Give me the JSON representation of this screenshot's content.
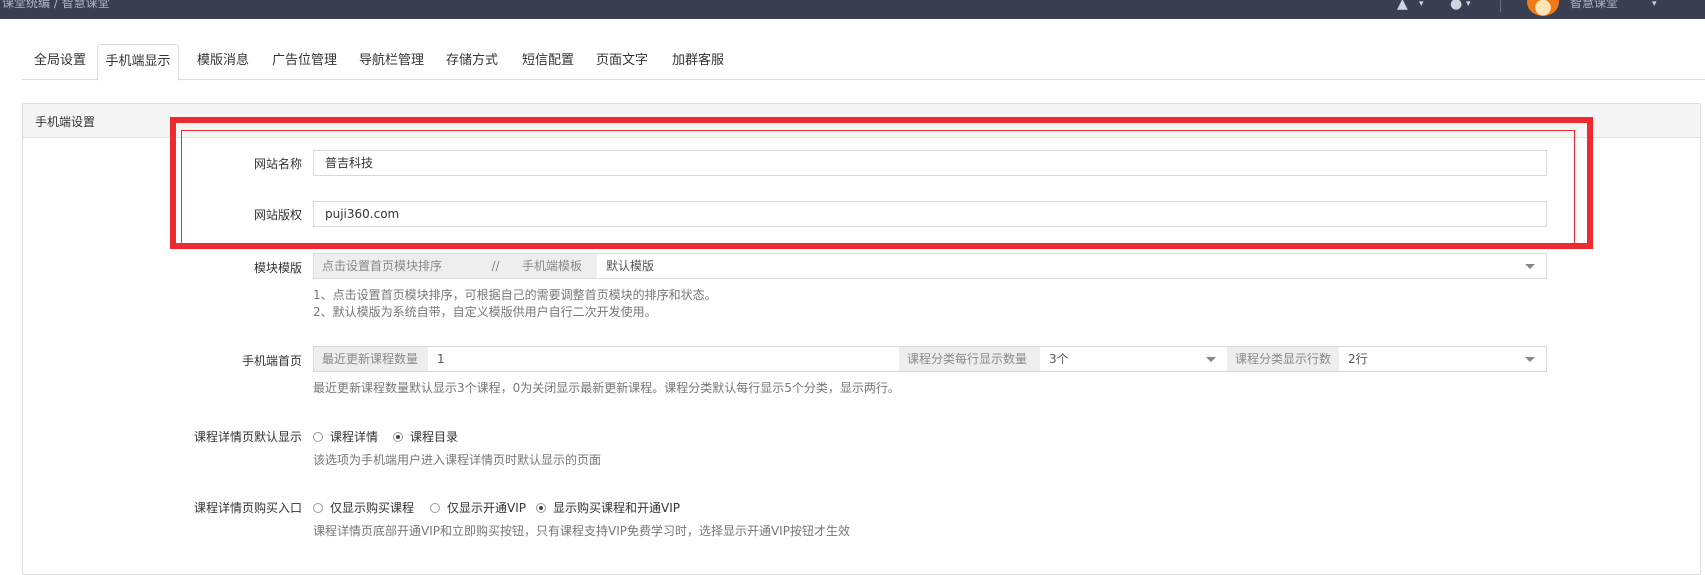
{
  "topbar": {
    "breadcrumb": "课堂统编 / 智慧课堂",
    "user_name": "智慧课堂",
    "bell_icon": "bell-icon",
    "user_icon": "user-icon",
    "chevron_icon": "chevron-down-icon"
  },
  "tabs": [
    {
      "label": "全局设置",
      "active": false
    },
    {
      "label": "手机端显示",
      "active": true
    },
    {
      "label": "模版消息",
      "active": false
    },
    {
      "label": "广告位管理",
      "active": false
    },
    {
      "label": "导航栏管理",
      "active": false
    },
    {
      "label": "存储方式",
      "active": false
    },
    {
      "label": "短信配置",
      "active": false
    },
    {
      "label": "页面文字",
      "active": false
    },
    {
      "label": "加群客服",
      "active": false
    }
  ],
  "panel": {
    "title": "手机端设置",
    "site_name": {
      "label": "网站名称",
      "value": "普吉科技"
    },
    "site_copyright": {
      "label": "网站版权",
      "value": "puji360.com"
    },
    "module_template": {
      "label": "模块模版",
      "addon_sort": "点击设置首页模块排序",
      "separator": "//",
      "addon_template": "手机端模板",
      "selected": "默认模版",
      "help_1": "1、点击设置首页模块排序，可根据自己的需要调整首页模块的排序和状态。",
      "help_2": "2、默认模版为系统自带，自定义模版供用户自行二次开发使用。"
    },
    "mobile_home": {
      "label": "手机端首页",
      "addon_recent": "最近更新课程数量",
      "recent_value": "1",
      "addon_per_row": "课程分类每行显示数量",
      "per_row_value": "3个",
      "addon_rows": "课程分类显示行数",
      "rows_value": "2行",
      "help": "最近更新课程数量默认显示3个课程，0为关闭显示最新更新课程。课程分类默认每行显示5个分类，显示两行。"
    },
    "detail_default": {
      "label": "课程详情页默认显示",
      "options": [
        {
          "label": "课程详情",
          "checked": false
        },
        {
          "label": "课程目录",
          "checked": true
        }
      ],
      "help": "该选项为手机端用户进入课程详情页时默认显示的页面"
    },
    "detail_buy": {
      "label": "课程详情页购买入口",
      "options": [
        {
          "label": "仅显示购买课程",
          "checked": false
        },
        {
          "label": "仅显示开通VIP",
          "checked": false
        },
        {
          "label": "显示购买课程和开通VIP",
          "checked": true
        }
      ],
      "help": "课程详情页底部开通VIP和立即购买按钮，只有课程支持VIP免费学习时，选择显示开通VIP按钮才生效"
    }
  },
  "highlight_color": "#ee2a2e"
}
